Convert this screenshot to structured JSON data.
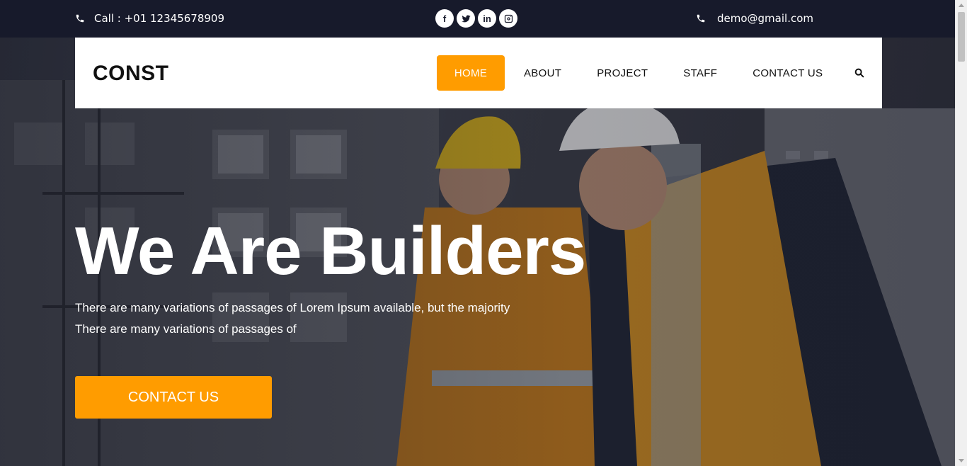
{
  "topbar": {
    "call_text": "Call : +01 12345678909",
    "email_text": "demo@gmail.com",
    "social": [
      {
        "icon": "facebook-icon",
        "glyph": "f"
      },
      {
        "icon": "twitter-icon",
        "glyph": ""
      },
      {
        "icon": "linkedin-icon",
        "glyph": "in"
      },
      {
        "icon": "instagram-icon",
        "glyph": ""
      }
    ]
  },
  "nav": {
    "logo": "CONST",
    "items": [
      {
        "label": "HOME",
        "active": true
      },
      {
        "label": "ABOUT"
      },
      {
        "label": "PROJECT"
      },
      {
        "label": "STAFF"
      },
      {
        "label": "CONTACT US"
      }
    ]
  },
  "hero": {
    "headline": "We Are Builders",
    "sub_line1": "There are many variations of passages of Lorem Ipsum available, but the majority",
    "sub_line2": "There are many variations of passages of",
    "cta_label": "CONTACT US"
  },
  "colors": {
    "accent": "#ff9c00",
    "topbar": "#171a2b",
    "nav_bg": "#ffffff"
  }
}
